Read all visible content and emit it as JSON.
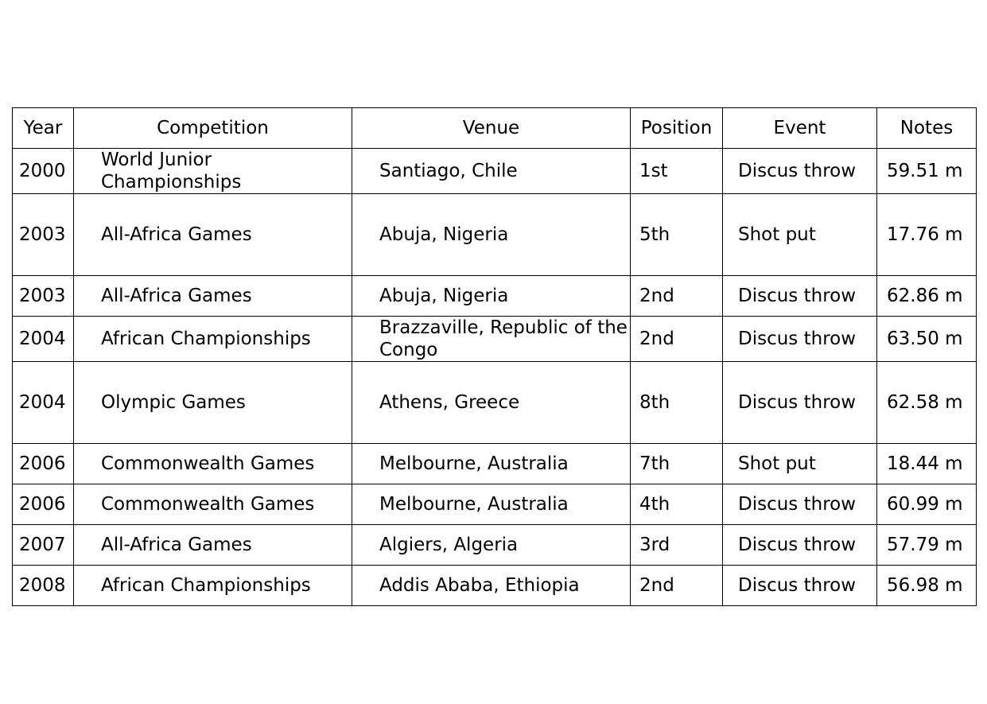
{
  "chart_data": {
    "type": "table",
    "columns": [
      "Year",
      "Competition",
      "Venue",
      "Position",
      "Event",
      "Notes"
    ],
    "rows": [
      [
        "2000",
        "World Junior Championships",
        "Santiago, Chile",
        "1st",
        "Discus throw",
        "59.51 m"
      ],
      [
        "2003",
        "All-Africa Games",
        "Abuja, Nigeria",
        "5th",
        "Shot put",
        "17.76 m"
      ],
      [
        "2003",
        "All-Africa Games",
        "Abuja, Nigeria",
        "2nd",
        "Discus throw",
        "62.86 m"
      ],
      [
        "2004",
        "African Championships",
        "Brazzaville, Republic of the Congo",
        "2nd",
        "Discus throw",
        "63.50 m"
      ],
      [
        "2004",
        "Olympic Games",
        "Athens, Greece",
        "8th",
        "Discus throw",
        "62.58 m"
      ],
      [
        "2006",
        "Commonwealth Games",
        "Melbourne, Australia",
        "7th",
        "Shot put",
        "18.44 m"
      ],
      [
        "2006",
        "Commonwealth Games",
        "Melbourne, Australia",
        "4th",
        "Discus throw",
        "60.99 m"
      ],
      [
        "2007",
        "All-Africa Games",
        "Algiers, Algeria",
        "3rd",
        "Discus throw",
        "57.79 m"
      ],
      [
        "2008",
        "African Championships",
        "Addis Ababa, Ethiopia",
        "2nd",
        "Discus throw",
        "56.98 m"
      ]
    ]
  }
}
